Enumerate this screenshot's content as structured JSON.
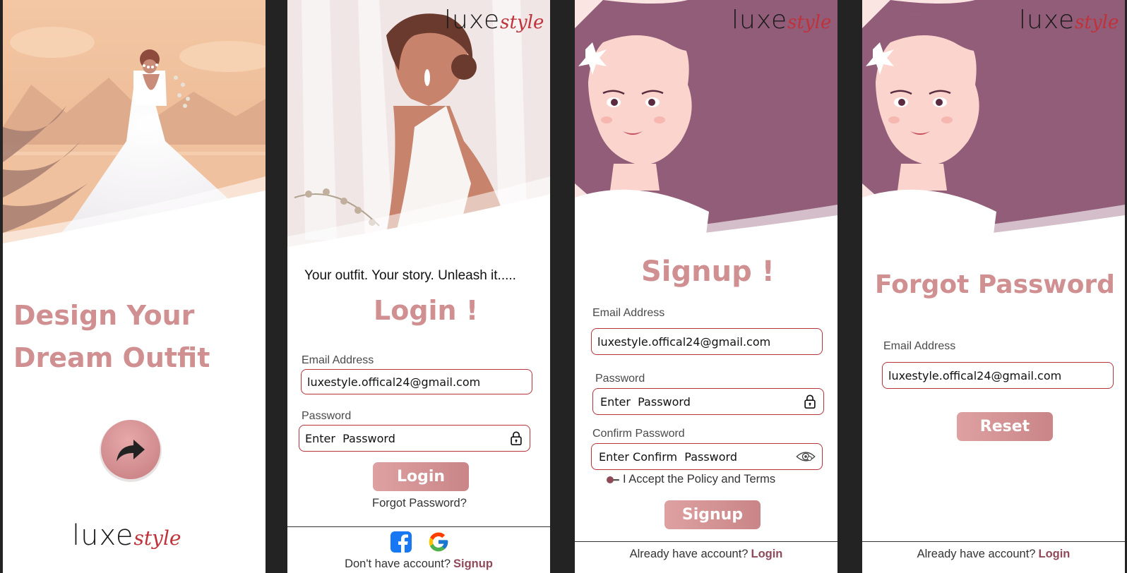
{
  "screens": {
    "welcome": {
      "title_line1": "Design Your",
      "title_line2": "Dream Outfit",
      "logo_luxe": "luxe",
      "logo_style": "style"
    },
    "login": {
      "logo_luxe": "luxe",
      "logo_style": "style",
      "tagline": "Your outfit. Your story. Unleash it.....",
      "title": "Login !",
      "email_label": "Email Address",
      "email_value": "luxestyle.offical24@gmail.com",
      "password_label": "Password",
      "password_placeholder": "Enter  Password",
      "login_button": "Login",
      "forgot_link": "Forgot  Password?",
      "footer_text": "Don't have account?",
      "footer_link": "Signup"
    },
    "signup": {
      "logo_luxe": "luxe",
      "logo_style": "style",
      "title": "Signup !",
      "email_label": "Email Address",
      "email_value": "luxestyle.offical24@gmail.com",
      "password_label": "Password",
      "password_placeholder": "Enter  Password",
      "confirm_label": "Confirm Password",
      "confirm_placeholder": "Enter Confirm  Password",
      "terms_text": "I Accept the Policy and Terms",
      "signup_button": "Signup",
      "footer_text": "Already have account?",
      "footer_link": "Login"
    },
    "forgot": {
      "logo_luxe": "luxe",
      "logo_style": "style",
      "title": "Forgot Password",
      "email_label": "Email Address",
      "email_value": "luxestyle.offical24@gmail.com",
      "reset_button": "Reset",
      "footer_text": "Already have account?",
      "footer_link": "Login"
    }
  },
  "icons": {
    "next": "share-arrow-icon",
    "lock": "lock-icon",
    "eye": "eye-icon",
    "facebook": "facebook-icon",
    "google": "google-icon",
    "toggle": "toggle-icon"
  },
  "colors": {
    "title": "#d08f90",
    "field_border": "#b8323a",
    "link": "#8f4a5a",
    "logo_accent": "#c0323a",
    "background": "#232323"
  }
}
